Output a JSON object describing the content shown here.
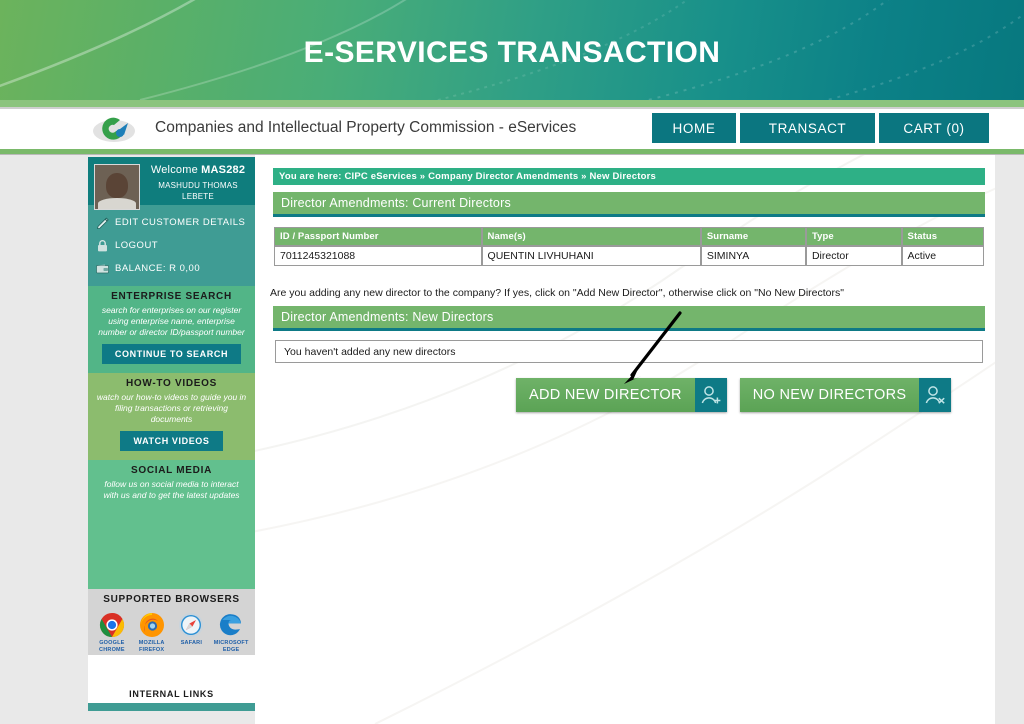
{
  "banner": {
    "title": "E-SERVICES TRANSACTION"
  },
  "header": {
    "site_name": "Companies and Intellectual Property Commission - eServices",
    "logo_alt": "cipc-logo",
    "nav": [
      {
        "label": "HOME",
        "name": "nav-home"
      },
      {
        "label": "TRANSACT",
        "name": "nav-transact"
      },
      {
        "label": "CART (0)",
        "name": "nav-cart"
      }
    ]
  },
  "sidebar": {
    "welcome_label": "Welcome ",
    "welcome_user": "MAS282",
    "user_fullname": "MASHUDU THOMAS LEBETE",
    "links": [
      {
        "label": "EDIT CUSTOMER DETAILS",
        "icon": "edit-pencil-icon"
      },
      {
        "label": "LOGOUT",
        "icon": "lock-icon"
      },
      {
        "label": "BALANCE: R 0,00",
        "icon": "wallet-icon"
      }
    ],
    "enterprise_search": {
      "heading": "ENTERPRISE SEARCH",
      "description": "search for enterprises on our register using enterprise name, enterprise number or director ID/passport number",
      "button": "CONTINUE TO SEARCH"
    },
    "howto_videos": {
      "heading": "HOW-TO VIDEOS",
      "description": "watch our how-to videos to guide you in filing transactions or retrieving documents",
      "button": "WATCH VIDEOS"
    },
    "social_media": {
      "heading": "SOCIAL MEDIA",
      "description": "follow us on social media to interact with us and to get the latest updates"
    },
    "supported_browsers": {
      "heading": "SUPPORTED BROWSERS",
      "items": [
        {
          "name": "GOOGLE CHROME",
          "icon": "chrome-icon"
        },
        {
          "name": "MOZILLA FIREFOX",
          "icon": "firefox-icon"
        },
        {
          "name": "SAFARI",
          "icon": "safari-icon"
        },
        {
          "name": "MICROSOFT EDGE",
          "icon": "edge-icon"
        }
      ]
    },
    "internal_links": {
      "heading": "INTERNAL LINKS"
    }
  },
  "main": {
    "breadcrumb": "You are here: CIPC eServices » Company Director Amendments » New Directors",
    "current_directors": {
      "section_title": "Director Amendments: Current Directors",
      "columns": [
        "ID / Passport Number",
        "Name(s)",
        "Surname",
        "Type",
        "Status"
      ],
      "rows": [
        {
          "id": "7011245321088",
          "names": "QUENTIN LIVHUHANI",
          "surname": "SIMINYA",
          "type": "Director",
          "status": "Active"
        }
      ]
    },
    "instruction": "Are you adding any new director to the company? If yes, click on \"Add New Director\", otherwise click on \"No New Directors\"",
    "new_directors": {
      "section_title": "Director Amendments: New Directors",
      "empty_message": "You haven't added any new directors"
    },
    "actions": [
      {
        "label": "ADD NEW DIRECTOR",
        "icon": "user-plus-icon",
        "name": "add-new-director-button"
      },
      {
        "label": "NO NEW DIRECTORS",
        "icon": "user-minus-icon",
        "name": "no-new-directors-button"
      }
    ]
  },
  "colors": {
    "banner_green": "#6cb35c",
    "banner_teal": "#07787f",
    "teal": "#0e7a86",
    "green": "#74b56c",
    "breadcrumb_green": "#2eb086",
    "sidebar_teal": "#3f9c94",
    "page_bg": "#e9e9e9"
  }
}
